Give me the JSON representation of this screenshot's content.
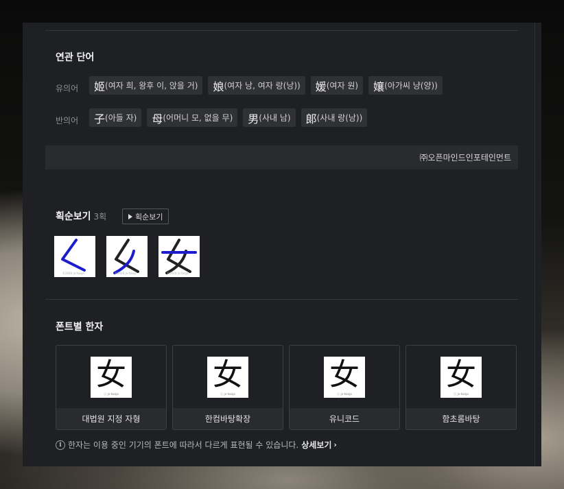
{
  "related": {
    "title": "연관 단어",
    "synonyms_label": "유의어",
    "antonyms_label": "반의어",
    "synonyms": [
      {
        "hanja": "姬",
        "reading": "(여자 희, 왕후 이, 앉을 거)"
      },
      {
        "hanja": "娘",
        "reading": "(여자 낭, 여자 랑(낭))"
      },
      {
        "hanja": "媛",
        "reading": "(여자 원)"
      },
      {
        "hanja": "孃",
        "reading": "(아가씨 냥(양))"
      }
    ],
    "antonyms": [
      {
        "hanja": "子",
        "reading": "(아들 자)"
      },
      {
        "hanja": "母",
        "reading": "(어머니 모, 없을 무)"
      },
      {
        "hanja": "男",
        "reading": "(사내 남)"
      },
      {
        "hanja": "郞",
        "reading": "(사내 랑(낭))"
      }
    ]
  },
  "copyright": "㈜오픈마인드인포테인먼트",
  "stroke": {
    "title": "획순보기",
    "count": "3획",
    "button_label": "획순보기",
    "watermark": "©2020 jn-hanja"
  },
  "fonts": {
    "title": "폰트별 한자",
    "glyph": "女",
    "watermark": "ⓒ jn-hanja",
    "cards": [
      {
        "label": "대법원 지정 자형"
      },
      {
        "label": "한컴바탕확장"
      },
      {
        "label": "유니코드"
      },
      {
        "label": "함초롬바탕"
      }
    ],
    "notice": "한자는 이용 중인 기기의 폰트에 따라서 다르게 표현될 수 있습니다.",
    "more_label": "상세보기"
  },
  "colors": {
    "panel": "#1f2023",
    "chip": "#303135",
    "stroke_line": "#1c1ccc"
  }
}
